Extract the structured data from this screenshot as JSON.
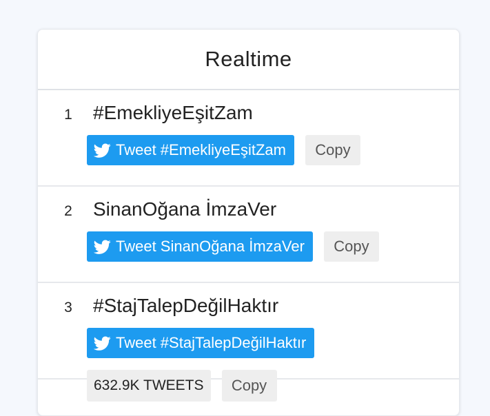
{
  "header": {
    "title": "Realtime"
  },
  "trends": [
    {
      "rank": "1",
      "topic": "#EmekliyeEşitZam",
      "tweet_label": "Tweet #EmekliyeEşitZam",
      "copy_label": "Copy"
    },
    {
      "rank": "2",
      "topic": "SinanOğana İmzaVer",
      "tweet_label": "Tweet SinanOğana İmzaVer",
      "copy_label": "Copy"
    },
    {
      "rank": "3",
      "topic": "#StajTalepDeğilHaktır",
      "tweet_label": "Tweet #StajTalepDeğilHaktır",
      "count": "632.9K TWEETS",
      "copy_label": "Copy"
    }
  ],
  "colors": {
    "tweet_button": "#1d9bf0",
    "copy_button": "#eeeeee",
    "background": "#f5f8fd"
  },
  "icons": {
    "tweet": "twitter-bird-icon"
  }
}
